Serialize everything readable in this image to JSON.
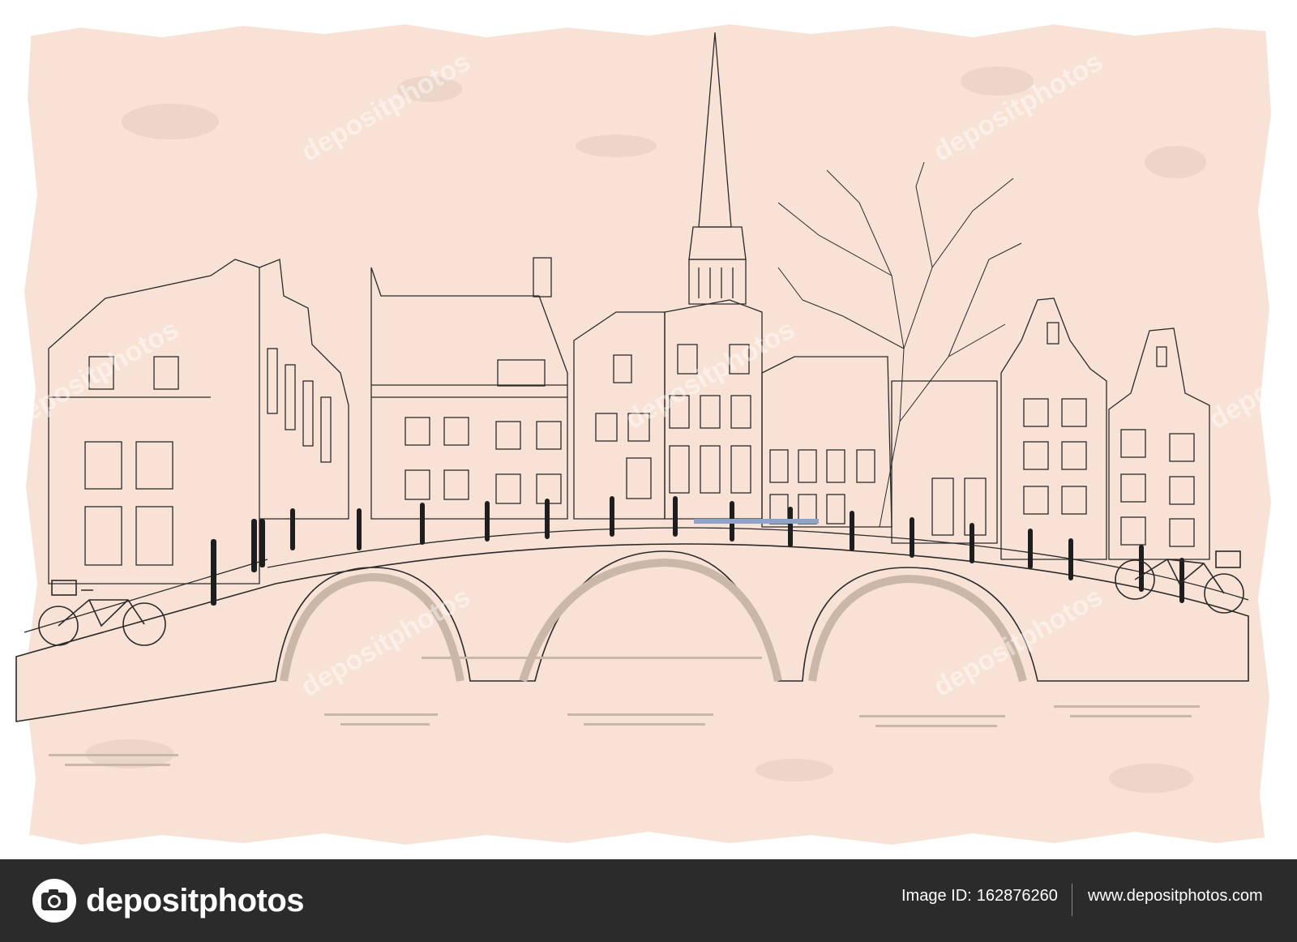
{
  "artwork": {
    "background_color": "#f7e2d5",
    "ink_color": "#2a2a2a",
    "accent_color": "#d8c6b6",
    "watermark_text": "depositphotos"
  },
  "footer": {
    "brand_name": "depositphotos",
    "image_id_label": "Image ID:",
    "image_id_value": "162876260",
    "site_url": "www.depositphotos.com",
    "background_color": "#2b2b2b",
    "logo_icon": "camera-icon"
  }
}
